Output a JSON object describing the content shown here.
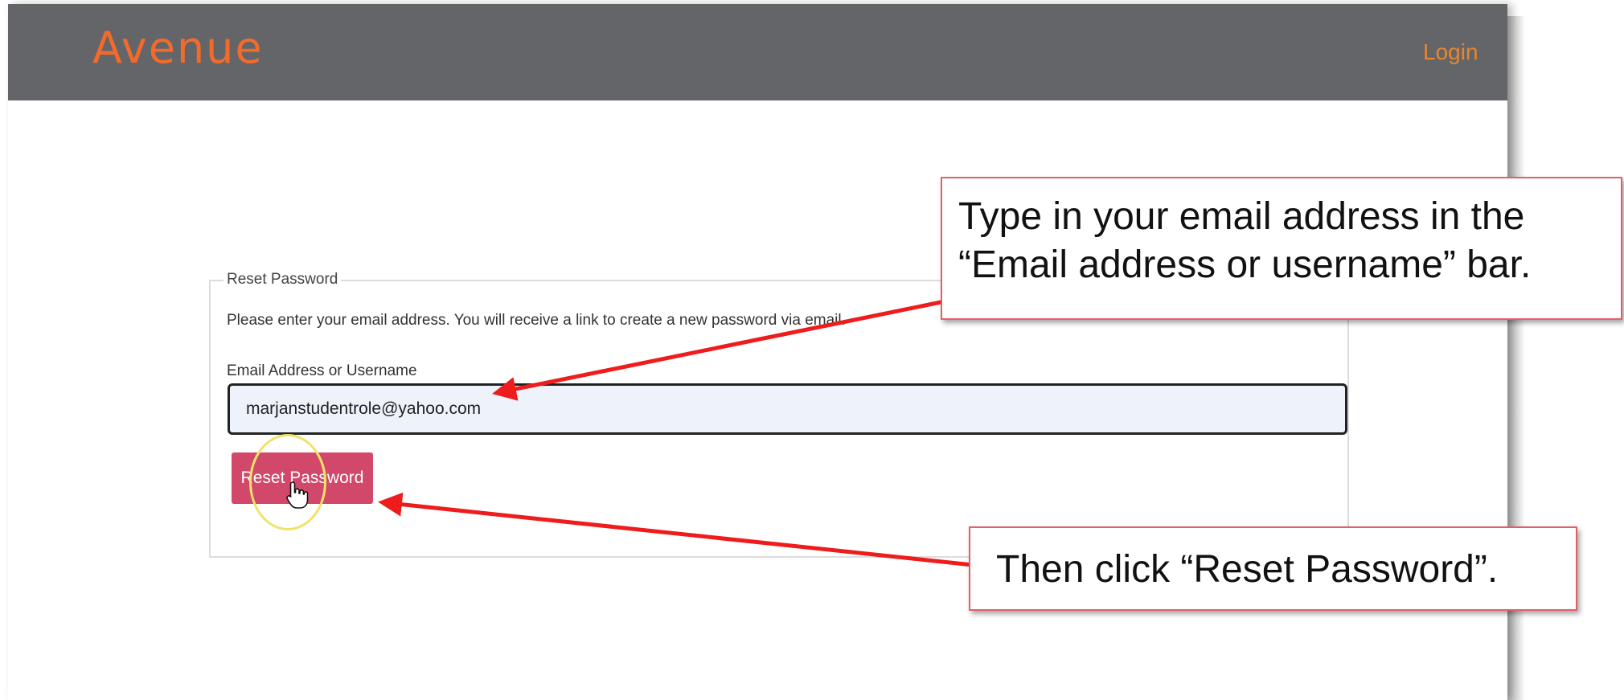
{
  "navbar": {
    "brand": "Avenue",
    "login_label": "Login"
  },
  "form": {
    "legend": "Reset Password",
    "instructions": "Please enter your email address. You will receive a link to create a new password via email.",
    "email_label": "Email Address or Username",
    "email_value": "marjanstudentrole@yahoo.com",
    "submit_label": "Reset Password"
  },
  "callouts": {
    "email_line1": "Type in your email address in the",
    "email_line2": "“Email address or username” bar.",
    "reset_text": "Then click “Reset Password”."
  },
  "colors": {
    "navbar": "#646569",
    "brand": "#f26b2a",
    "login": "#e8862f",
    "button": "#d2486b",
    "arrow": "#ee1c1c",
    "callout_border": "#e0606a"
  },
  "icons": {
    "cursor": "hand-pointer-icon"
  }
}
